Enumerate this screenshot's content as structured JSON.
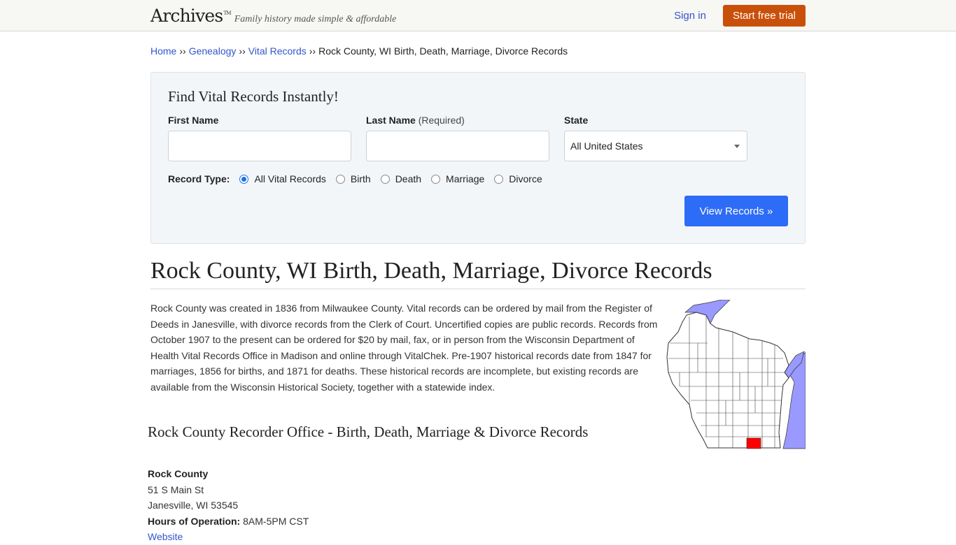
{
  "header": {
    "logo": "Archives",
    "logo_tm": "TM",
    "tagline": "Family history made simple & affordable",
    "signin_label": "Sign in",
    "trial_label": "Start free trial",
    "trial_color": "#c9500a"
  },
  "breadcrumb": {
    "items": [
      {
        "label": "Home"
      },
      {
        "label": "Genealogy"
      },
      {
        "label": "Vital Records"
      }
    ],
    "separator": "››",
    "current": "Rock County, WI Birth, Death, Marriage, Divorce Records"
  },
  "search": {
    "title": "Find Vital Records Instantly!",
    "first_name_label": "First Name",
    "first_name_value": "",
    "last_name_label": "Last Name",
    "last_name_required": "(Required)",
    "last_name_value": "",
    "state_label": "State",
    "state_value": "All United States",
    "record_type_label": "Record Type:",
    "record_types": [
      {
        "label": "All Vital Records",
        "checked": true
      },
      {
        "label": "Birth",
        "checked": false
      },
      {
        "label": "Death",
        "checked": false
      },
      {
        "label": "Marriage",
        "checked": false
      },
      {
        "label": "Divorce",
        "checked": false
      }
    ],
    "submit_label": "View Records »",
    "submit_color": "#2d6cf6"
  },
  "page": {
    "title": "Rock County, WI Birth, Death, Marriage, Divorce Records",
    "intro": "Rock County was created in 1836 from Milwaukee County. Vital records can be ordered by mail from the Register of Deeds in Janesville, with divorce records from the Clerk of Court. Uncertified copies are public records. Records from October 1907 to the present can be ordered for $20 by mail, fax, or in person from the Wisconsin Department of Health Vital Records Office in Madison and online through VitalChek. Pre-1907 historical records date from 1847 for marriages, 1856 for births, and 1871 for deaths. These historical records are incomplete, but existing records are available from the Wisconsin Historical Society, together with a statewide index.",
    "map_alt": "Wisconsin county map with Rock County highlighted",
    "map_highlight_color": "#ff0000",
    "map_water_color": "#9999ff",
    "section_title": "Rock County Recorder Office - Birth, Death, Marriage & Divorce Records"
  },
  "office": {
    "name": "Rock County",
    "street": "51 S Main St",
    "city": "Janesville, WI 53545",
    "hours_label": "Hours of Operation:",
    "hours_value": "8AM-5PM CST",
    "website_label": "Website"
  }
}
